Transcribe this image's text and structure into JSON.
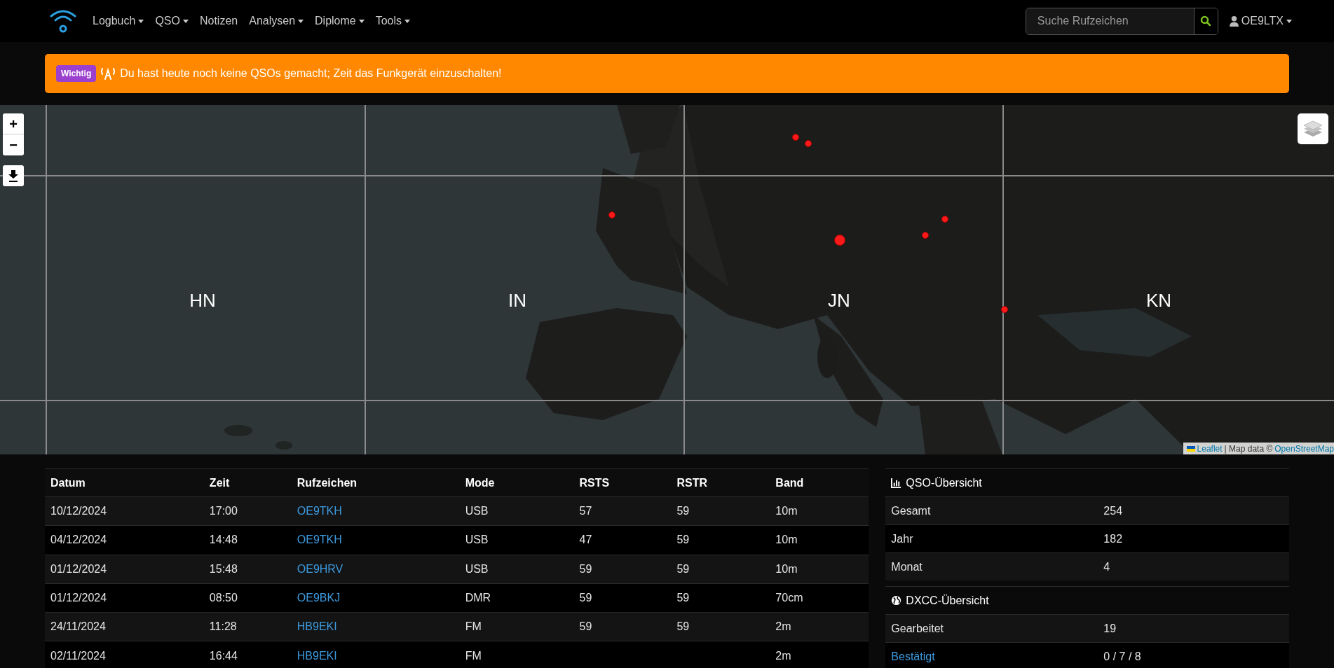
{
  "nav": {
    "items": [
      {
        "label": "Logbuch",
        "dropdown": true
      },
      {
        "label": "QSO",
        "dropdown": true
      },
      {
        "label": "Notizen",
        "dropdown": false
      },
      {
        "label": "Analysen",
        "dropdown": true
      },
      {
        "label": "Diplome",
        "dropdown": true
      },
      {
        "label": "Tools",
        "dropdown": true
      }
    ],
    "search": {
      "placeholder": "Suche Rufzeichen"
    },
    "user": {
      "label": "OE9LTX",
      "dropdown": true
    }
  },
  "alert": {
    "badge": "Wichtig",
    "text": "Du hast heute noch keine QSOs gemacht; Zeit das Funkgerät einzuschalten!"
  },
  "map": {
    "zoom_in": "+",
    "zoom_out": "−",
    "grid_labels": [
      "HN",
      "IN",
      "JN",
      "KN"
    ],
    "attribution": {
      "link": "Leaflet",
      "text": "| Map data ©",
      "source": "OpenStreetMap"
    }
  },
  "log": {
    "columns": [
      "Datum",
      "Zeit",
      "Rufzeichen",
      "Mode",
      "RSTS",
      "RSTR",
      "Band"
    ],
    "rows": [
      [
        "10/12/2024",
        "17:00",
        "OE9TKH",
        "USB",
        "57",
        "59",
        "10m"
      ],
      [
        "04/12/2024",
        "14:48",
        "OE9TKH",
        "USB",
        "47",
        "59",
        "10m"
      ],
      [
        "01/12/2024",
        "15:48",
        "OE9HRV",
        "USB",
        "59",
        "59",
        "10m"
      ],
      [
        "01/12/2024",
        "08:50",
        "OE9BKJ",
        "DMR",
        "59",
        "59",
        "70cm"
      ],
      [
        "24/11/2024",
        "11:28",
        "HB9EKI",
        "FM",
        "59",
        "59",
        "2m"
      ],
      [
        "02/11/2024",
        "16:44",
        "HB9EKI",
        "FM",
        null,
        null,
        "2m"
      ]
    ]
  },
  "summary": [
    {
      "title": "QSO-Übersicht",
      "rows": [
        {
          "label": "Gesamt",
          "value": "254",
          "link": false
        },
        {
          "label": "Jahr",
          "value": "182",
          "link": false
        },
        {
          "label": "Monat",
          "value": "4",
          "link": false
        }
      ]
    },
    {
      "title": "DXCC-Übersicht",
      "rows": [
        {
          "label": "Gearbeitet",
          "value": "19",
          "link": false
        },
        {
          "label": "Bestätigt",
          "value": "0 / 7 / 8",
          "link": true
        }
      ]
    }
  ]
}
